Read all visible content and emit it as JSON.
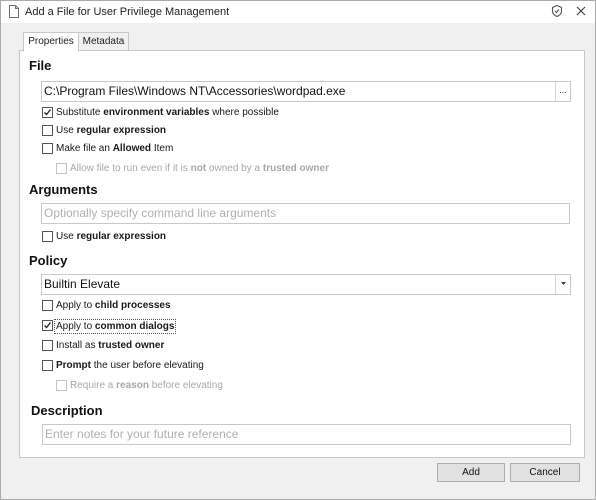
{
  "window": {
    "title": "Add a File for User Privilege Management"
  },
  "tabs": [
    {
      "label": "Properties"
    },
    {
      "label": "Metadata"
    }
  ],
  "file": {
    "heading": "File",
    "path_value": "C:\\Program Files\\Windows NT\\Accessories\\wordpad.exe",
    "browse_label": "...",
    "options": [
      {
        "parts": [
          "Substitute ",
          "environment variables",
          " where possible"
        ],
        "checked": true
      },
      {
        "parts": [
          "Use ",
          "regular expression",
          ""
        ],
        "checked": false
      },
      {
        "parts": [
          "Make file an ",
          "Allowed",
          " Item"
        ],
        "checked": false
      }
    ],
    "sub_option": {
      "parts": [
        "Allow file to run even if it is ",
        "not",
        " owned by a ",
        "trusted owner"
      ],
      "checked": false,
      "disabled": true
    }
  },
  "arguments": {
    "heading": "Arguments",
    "placeholder": "Optionally specify command line arguments",
    "regex_option": {
      "parts": [
        "Use ",
        "regular expression",
        ""
      ],
      "checked": false
    }
  },
  "policy": {
    "heading": "Policy",
    "selected": "Builtin Elevate",
    "options": [
      {
        "parts": [
          "Apply to ",
          "child processes",
          ""
        ],
        "checked": false
      },
      {
        "parts": [
          "Apply to ",
          "common dialogs",
          ""
        ],
        "checked": true
      },
      {
        "parts": [
          "Install as ",
          "trusted owner",
          ""
        ],
        "checked": false
      },
      {
        "parts": [
          "",
          "Prompt",
          " the user before elevating"
        ],
        "checked": false
      }
    ],
    "sub_option": {
      "parts": [
        "Require a ",
        "reason",
        " before elevating"
      ],
      "checked": false,
      "disabled": true
    }
  },
  "description": {
    "heading": "Description",
    "placeholder": "Enter notes for your future reference"
  },
  "buttons": {
    "add": "Add",
    "cancel": "Cancel"
  },
  "colors": {
    "window_bg": "#f0f0f0",
    "panel_bg": "#ffffff",
    "placeholder_text": "#b0b0b0",
    "disabled_text": "#a8a8a8"
  }
}
